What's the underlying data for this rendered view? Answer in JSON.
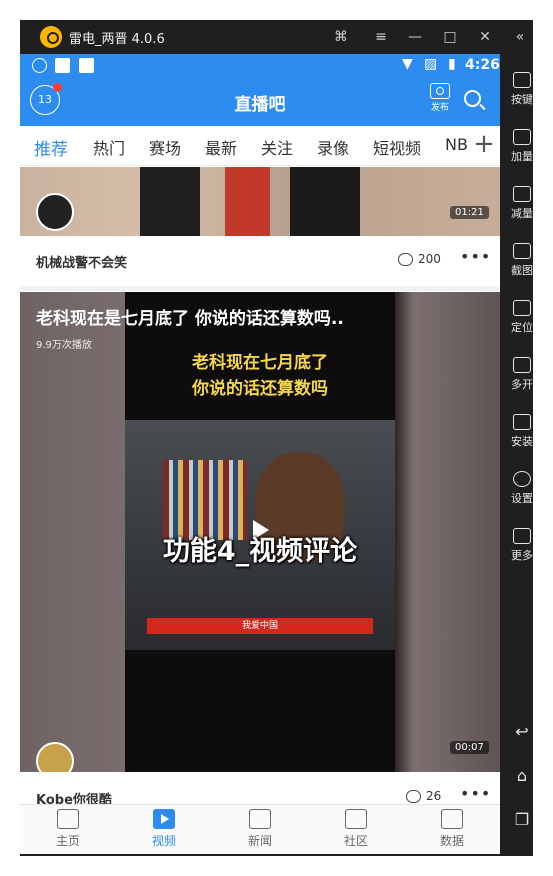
{
  "emulator": {
    "title": "雷电_两晋 4.0.6",
    "controls": {
      "gamepad": "gamepad-icon",
      "menu": "menu-icon",
      "minimize": "minimize-icon",
      "maximize": "maximize-icon",
      "close": "close-icon",
      "collapse": "collapse-icon"
    },
    "sidebar": [
      {
        "label": "按键",
        "icon": "keyboard-icon"
      },
      {
        "label": "加量",
        "icon": "volume-up-icon"
      },
      {
        "label": "减量",
        "icon": "volume-down-icon"
      },
      {
        "label": "截图",
        "icon": "screenshot-icon"
      },
      {
        "label": "定位",
        "icon": "location-icon"
      },
      {
        "label": "多开",
        "icon": "multi-instance-icon"
      },
      {
        "label": "安装",
        "icon": "install-icon"
      },
      {
        "label": "设置",
        "icon": "settings-icon"
      },
      {
        "label": "更多",
        "icon": "more-icon"
      }
    ],
    "android_nav": {
      "back": "back-icon",
      "home": "home-icon",
      "recents": "recents-icon"
    }
  },
  "statusbar": {
    "time": "4:26",
    "battery_color": "#ffffff"
  },
  "appbar": {
    "title": "直播吧",
    "message_count": "13",
    "publish_label": "发布",
    "accent_color": "#2d8cf0"
  },
  "tabs": [
    "推荐",
    "热门",
    "赛场",
    "最新",
    "关注",
    "录像",
    "短视频",
    "NB"
  ],
  "active_tab": "推荐",
  "feed": [
    {
      "uploader": "机械战警不会笑",
      "duration": "01:21",
      "comments": "200"
    },
    {
      "title": "老科现在是七月底了 你说的话还算数吗..",
      "views": "9.9万次播放",
      "video_caption": "老科现在七月底了\n你说的话还算数吗",
      "banner": "我爱中国",
      "overlay_label": "功能4_视频评论",
      "duration": "00:07",
      "uploader": "Kobe你很酷",
      "comments": "26"
    }
  ],
  "bottom_nav": [
    {
      "label": "主页",
      "icon": "home-icon"
    },
    {
      "label": "视频",
      "icon": "video-icon"
    },
    {
      "label": "新闻",
      "icon": "news-icon"
    },
    {
      "label": "社区",
      "icon": "community-icon"
    },
    {
      "label": "数据",
      "icon": "data-icon"
    }
  ],
  "active_nav": "视频"
}
